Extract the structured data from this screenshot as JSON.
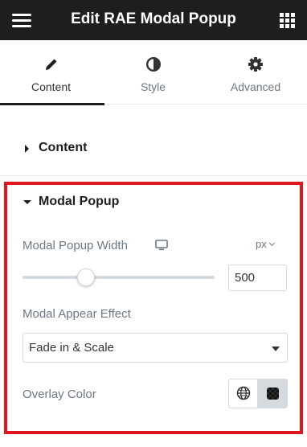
{
  "header": {
    "title": "Edit RAE Modal Popup",
    "menu_icon": "hamburger-icon",
    "apps_icon": "grid-icon",
    "background": "#1e1e1e"
  },
  "tabs": [
    {
      "label": "Content",
      "icon": "pencil-icon",
      "active": true
    },
    {
      "label": "Style",
      "icon": "half-circle-icon",
      "active": false
    },
    {
      "label": "Advanced",
      "icon": "gear-icon",
      "active": false
    }
  ],
  "sections": {
    "content": {
      "title": "Content",
      "expanded": false
    },
    "modal_popup": {
      "title": "Modal Popup",
      "expanded": true
    }
  },
  "controls": {
    "width": {
      "label": "Modal Popup Width",
      "device_icon": "monitor-icon",
      "unit": "px",
      "value": "500",
      "slider_fraction": 0.33
    },
    "appear_effect": {
      "label": "Modal Appear Effect",
      "selected": "Fade in & Scale"
    },
    "overlay_color": {
      "label": "Overlay Color",
      "global_icon": "globe-icon",
      "value": "#1c1c1c"
    }
  },
  "colors": {
    "highlight": "#e0161e",
    "active_tab_underline": "#1e1e1e",
    "label_text": "#6d7882"
  }
}
